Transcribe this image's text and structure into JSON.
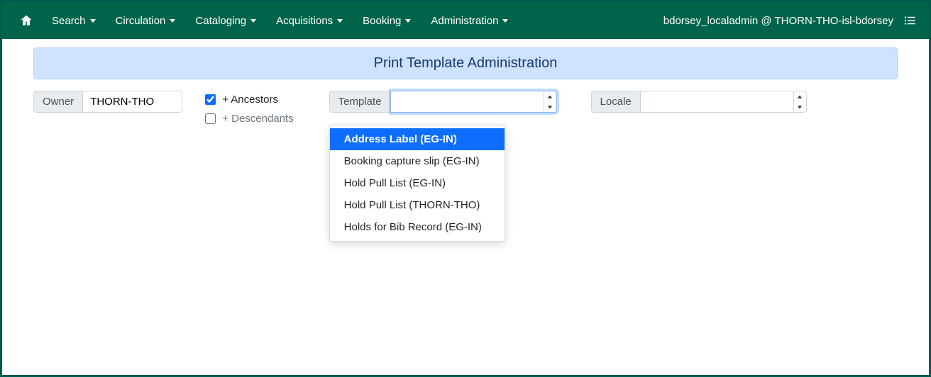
{
  "navbar": {
    "search": "Search",
    "circulation": "Circulation",
    "cataloging": "Cataloging",
    "acquisitions": "Acquisitions",
    "booking": "Booking",
    "administration": "Administration",
    "user_info": "bdorsey_localadmin @ THORN-THO-isl-bdorsey"
  },
  "page": {
    "title": "Print Template Administration"
  },
  "filters": {
    "owner_label": "Owner",
    "owner_value": "THORN-THO",
    "ancestors_label": "+ Ancestors",
    "ancestors_checked": true,
    "descendants_label": "+ Descendants",
    "descendants_checked": false,
    "template_label": "Template",
    "template_value": "",
    "template_options": [
      "Address Label (EG-IN)",
      "Booking capture slip (EG-IN)",
      "Hold Pull List (EG-IN)",
      "Hold Pull List (THORN-THO)",
      "Holds for Bib Record (EG-IN)"
    ],
    "locale_label": "Locale",
    "locale_value": ""
  }
}
